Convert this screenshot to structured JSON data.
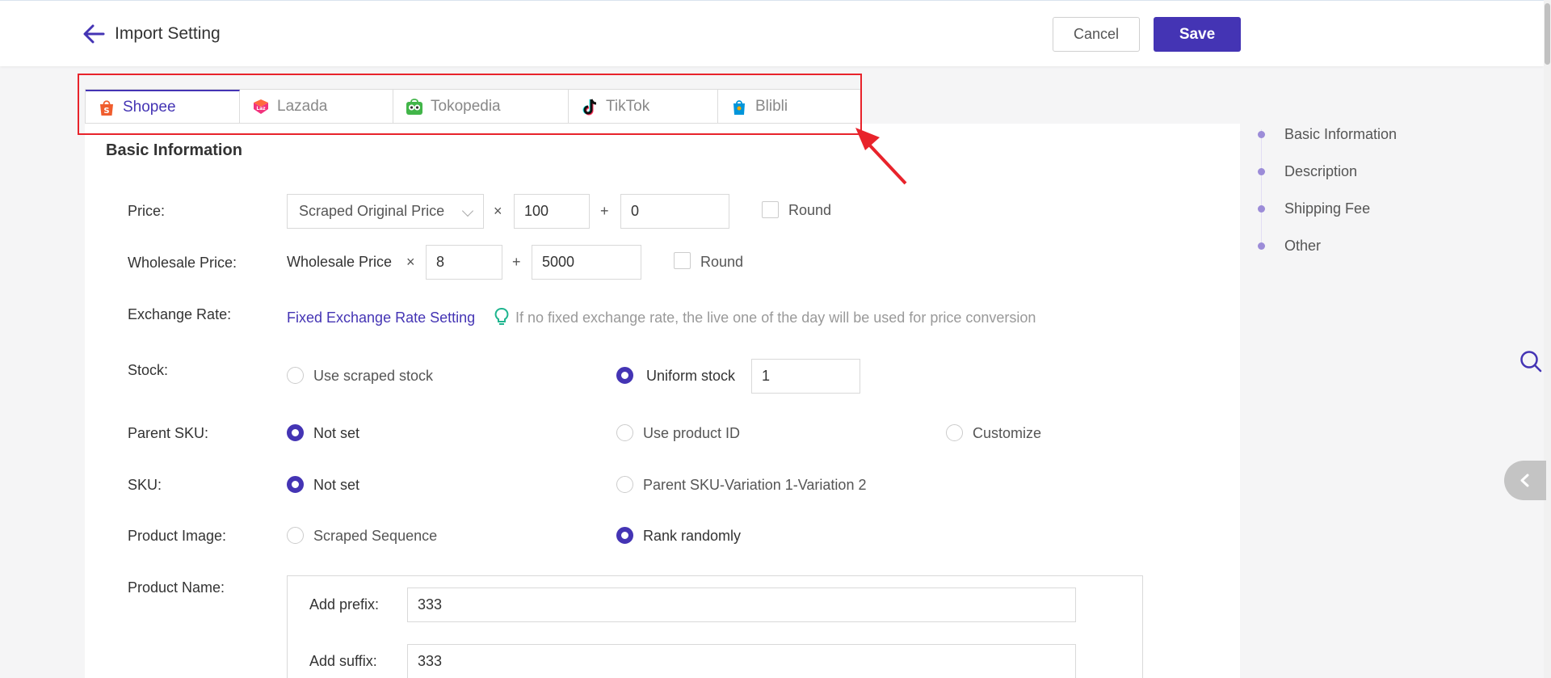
{
  "header": {
    "title": "Import Setting",
    "cancel_label": "Cancel",
    "save_label": "Save"
  },
  "tabs": [
    {
      "label": "Shopee",
      "icon": "shopee-icon",
      "active": true
    },
    {
      "label": "Lazada",
      "icon": "lazada-icon",
      "active": false
    },
    {
      "label": "Tokopedia",
      "icon": "tokopedia-icon",
      "active": false
    },
    {
      "label": "TikTok",
      "icon": "tiktok-icon",
      "active": false
    },
    {
      "label": "Blibli",
      "icon": "blibli-icon",
      "active": false
    }
  ],
  "section": {
    "title": "Basic Information"
  },
  "form": {
    "price": {
      "label": "Price:",
      "source": "Scraped Original Price",
      "times": "×",
      "multiplier": "100",
      "plus": "+",
      "addend": "0",
      "round_label": "Round"
    },
    "wholesale": {
      "label": "Wholesale Price:",
      "source": "Wholesale Price",
      "times": "×",
      "multiplier": "8",
      "plus": "+",
      "addend": "5000",
      "round_label": "Round"
    },
    "exchange": {
      "label": "Exchange Rate:",
      "link": "Fixed Exchange Rate Setting",
      "hint": "If no fixed exchange rate, the live one of the day will be used for price conversion"
    },
    "stock": {
      "label": "Stock:",
      "opt1": "Use scraped stock",
      "opt2": "Uniform stock",
      "value": "1",
      "selected": "Uniform stock"
    },
    "parent_sku": {
      "label": "Parent SKU:",
      "opt1": "Not set",
      "opt2": "Use product ID",
      "opt3": "Customize",
      "selected": "Not set"
    },
    "sku": {
      "label": "SKU:",
      "opt1": "Not set",
      "opt2": "Parent SKU-Variation 1-Variation 2",
      "selected": "Not set"
    },
    "product_image": {
      "label": "Product Image:",
      "opt1": "Scraped Sequence",
      "opt2": "Rank randomly",
      "selected": "Rank randomly"
    },
    "product_name": {
      "label": "Product Name:",
      "prefix_label": "Add prefix:",
      "prefix_value": "333",
      "suffix_label": "Add suffix:",
      "suffix_value": "333"
    }
  },
  "toc": [
    "Basic Information",
    "Description",
    "Shipping Fee",
    "Other"
  ],
  "colors": {
    "accent": "#4434b4",
    "highlight": "#e8232b"
  }
}
